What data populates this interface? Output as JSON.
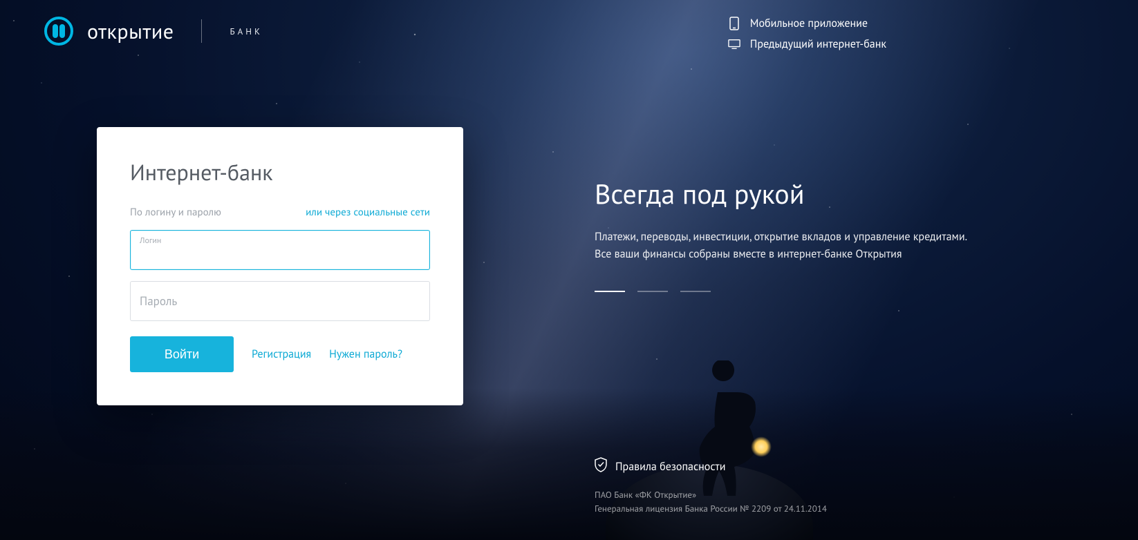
{
  "brand": {
    "name": "открытие",
    "sub": "БАНК"
  },
  "topLinks": {
    "mobile": "Мобильное приложение",
    "prevBank": "Предыдущий интернет-банк"
  },
  "login": {
    "title": "Интернет-банк",
    "tabActive": "По логину и паролю",
    "tabAlt": "или через социальные сети",
    "loginLabel": "Логин",
    "passwordLabel": "Пароль",
    "submit": "Войти",
    "register": "Регистрация",
    "forgot": "Нужен пароль?"
  },
  "hero": {
    "title": "Всегда под рукой",
    "desc": "Платежи, переводы, инвестиции, открытие вкладов и управление кредитами. Все ваши финансы собраны вместе в интернет-банке Открытия"
  },
  "footer": {
    "security": "Правила безопасности",
    "legal1": "ПАО Банк «ФК Открытие»",
    "legal2": "Генеральная лицензия Банка России № 2209 от 24.11.2014"
  }
}
